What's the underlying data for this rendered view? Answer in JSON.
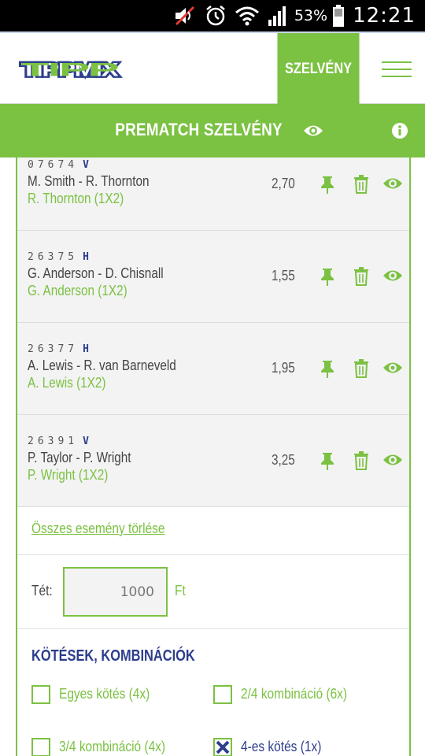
{
  "status_bar": {
    "battery": "53%",
    "time": "12:21",
    "icons": [
      "muted-speaker-icon",
      "alarm-icon",
      "wifi-icon",
      "signal-icon",
      "battery-icon"
    ]
  },
  "header": {
    "logo": "TIPPMIX",
    "szelveny_button": "SZELVÉNY",
    "menu_icon": "hamburger-icon"
  },
  "title_bar": {
    "title": "PREMATCH SZELVÉNY",
    "eye_icon": "eye-icon",
    "info_icon": "info-icon"
  },
  "bets": [
    {
      "code": "07674",
      "side": "V",
      "match": "M. Smith - R. Thornton",
      "pick": "R. Thornton (1X2)",
      "odds": "2,70"
    },
    {
      "code": "26375",
      "side": "H",
      "match": "G. Anderson - D. Chisnall",
      "pick": "G. Anderson (1X2)",
      "odds": "1,55"
    },
    {
      "code": "26377",
      "side": "H",
      "match": "A. Lewis - R. van Barneveld",
      "pick": "A. Lewis (1X2)",
      "odds": "1,95"
    },
    {
      "code": "26391",
      "side": "V",
      "match": "P. Taylor - P. Wright",
      "pick": "P. Wright (1X2)",
      "odds": "3,25"
    }
  ],
  "clear_all_link": "Összes esemény törlése",
  "stake": {
    "label": "Tét:",
    "value": "1000",
    "unit": "Ft"
  },
  "combinations": {
    "title": "KÖTÉSEK, KOMBINÁCIÓK",
    "options": [
      {
        "label": "Egyes kötés (4x)",
        "checked": false
      },
      {
        "label": "2/4 kombináció (6x)",
        "checked": false
      },
      {
        "label": "3/4 kombináció (4x)",
        "checked": false
      },
      {
        "label": "4-es kötés (1x)",
        "checked": true
      }
    ]
  },
  "colors": {
    "brand_green": "#7bc142",
    "brand_blue": "#2c3e8c",
    "row_bg": "#f3f3f3"
  }
}
